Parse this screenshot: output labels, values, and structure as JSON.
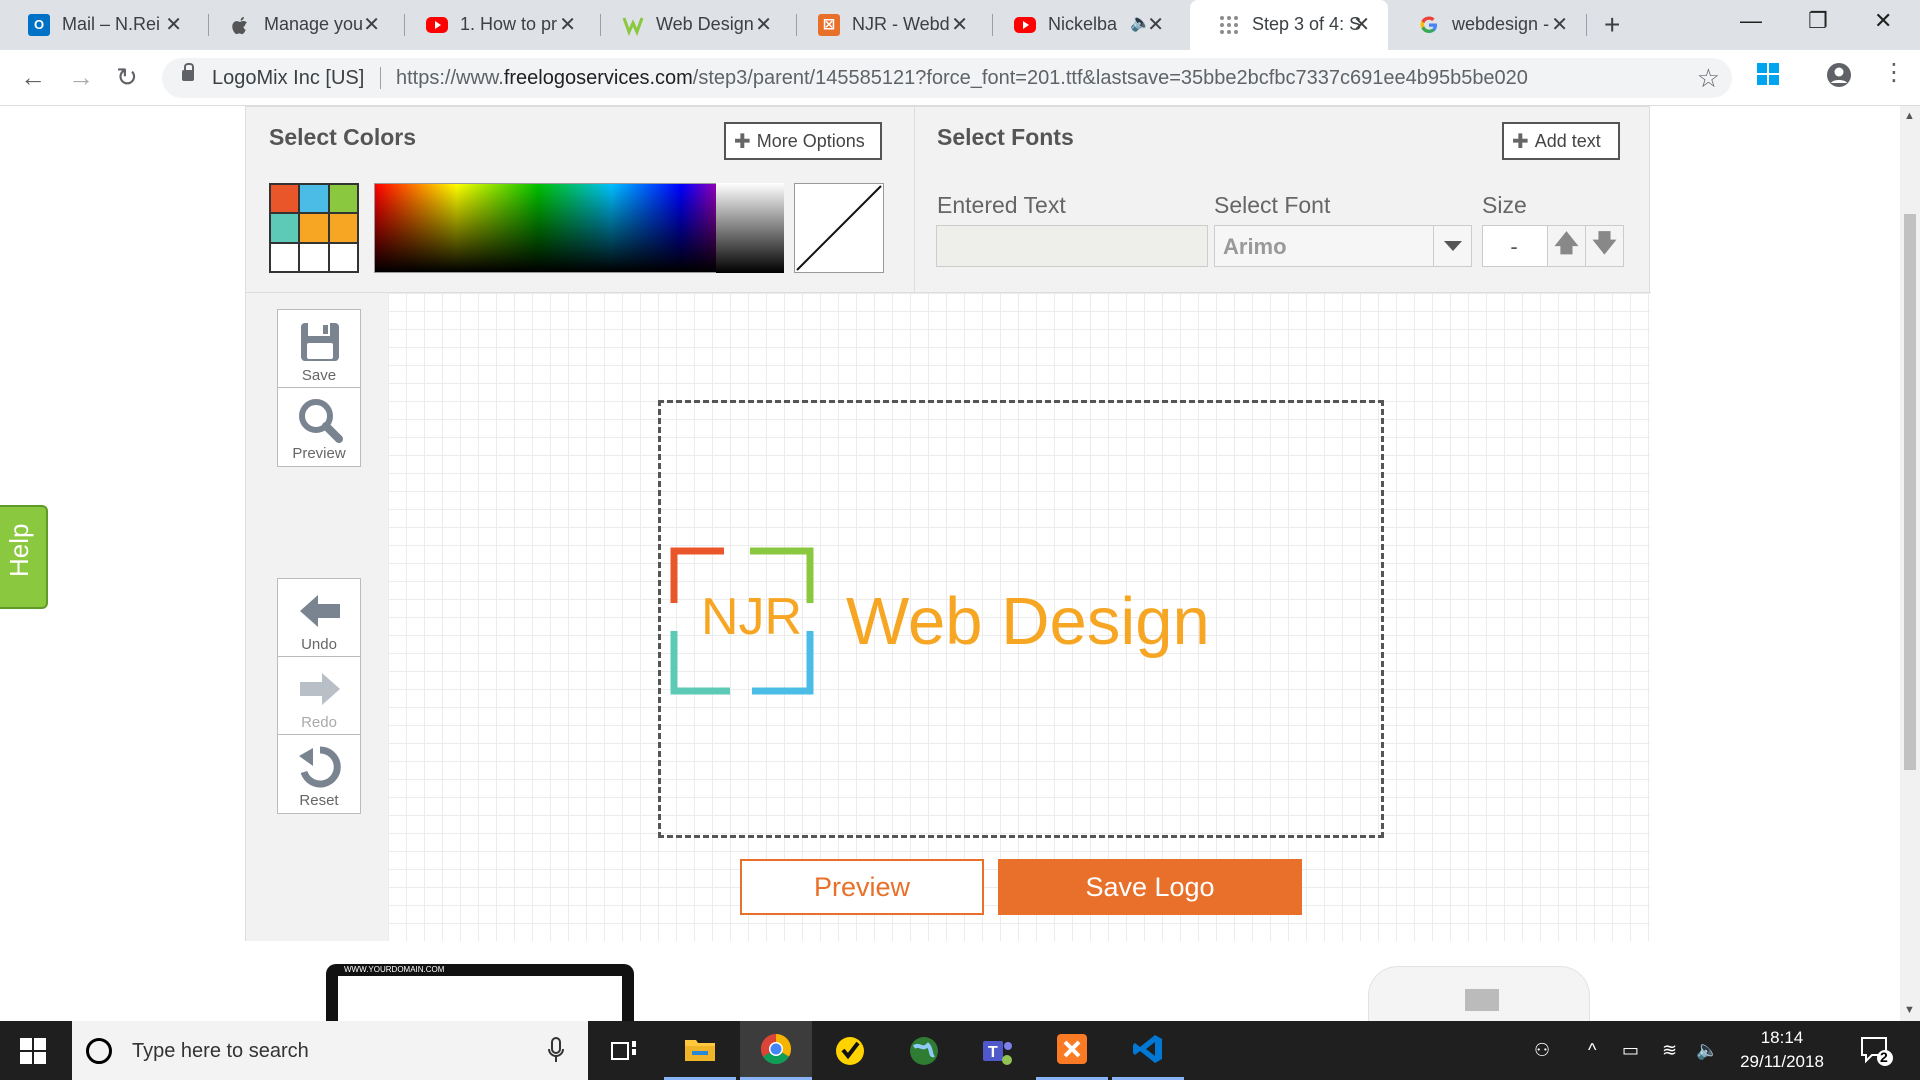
{
  "browser": {
    "tabs": [
      {
        "label": "Mail – N.Rei",
        "favicon_color": "#0072c6",
        "active": false
      },
      {
        "label": "Manage you",
        "favicon_color": "#555555",
        "active": false
      },
      {
        "label": "1. How to pr",
        "favicon_color": "#ff0000",
        "active": false
      },
      {
        "label": "Web Design",
        "favicon_color": "#8ac83f",
        "active": false
      },
      {
        "label": "NJR - Webd",
        "favicon_color": "#e8702a",
        "active": false
      },
      {
        "label": "Nickelba",
        "favicon_color": "#ff0000",
        "active": false,
        "audio": true
      },
      {
        "label": "Step 3 of 4: S",
        "favicon_color": "#8c8c8c",
        "active": true
      },
      {
        "label": "webdesign -",
        "favicon_color": "#4285f4",
        "active": false
      }
    ],
    "site_identity": "LogoMix Inc [US]",
    "url_prefix": "https://www.",
    "url_domain": "freelogoservices.com",
    "url_path": "/step3/parent/145585121?force_font=201.ttf&lastsave=35bbe2bcfbc7337c691ee4b95b5be020"
  },
  "colors_panel": {
    "title": "Select Colors",
    "more_options_label": "More Options",
    "swatches": [
      "#e8562a",
      "#4bbce6",
      "#8ac83f",
      "#5ccab6",
      "#f6a623",
      "#f6a623",
      "#ffffff",
      "#ffffff",
      "#ffffff"
    ]
  },
  "fonts_panel": {
    "title": "Select Fonts",
    "add_text_label": "Add text",
    "entered_text_label": "Entered Text",
    "entered_text_value": "",
    "select_font_label": "Select Font",
    "font_value": "Arimo",
    "size_label": "Size",
    "size_value": "-"
  },
  "tools": {
    "save": "Save",
    "preview": "Preview",
    "undo": "Undo",
    "redo": "Redo",
    "reset": "Reset"
  },
  "logo": {
    "monogram": "NJR",
    "name": "Web Design",
    "text_color": "#f6a623",
    "frame_colors": [
      "#e8562a",
      "#8ac83f",
      "#5ccab6",
      "#4bbce6"
    ]
  },
  "actions": {
    "preview_label": "Preview",
    "save_logo_label": "Save Logo",
    "accent": "#e8702a"
  },
  "help_label": "Help",
  "product_preview": {
    "laptop_url": "WWW.YOURDOMAIN.COM"
  },
  "taskbar": {
    "search_placeholder": "Type here to search",
    "time": "18:14",
    "date": "29/11/2018",
    "notification_count": "2"
  }
}
